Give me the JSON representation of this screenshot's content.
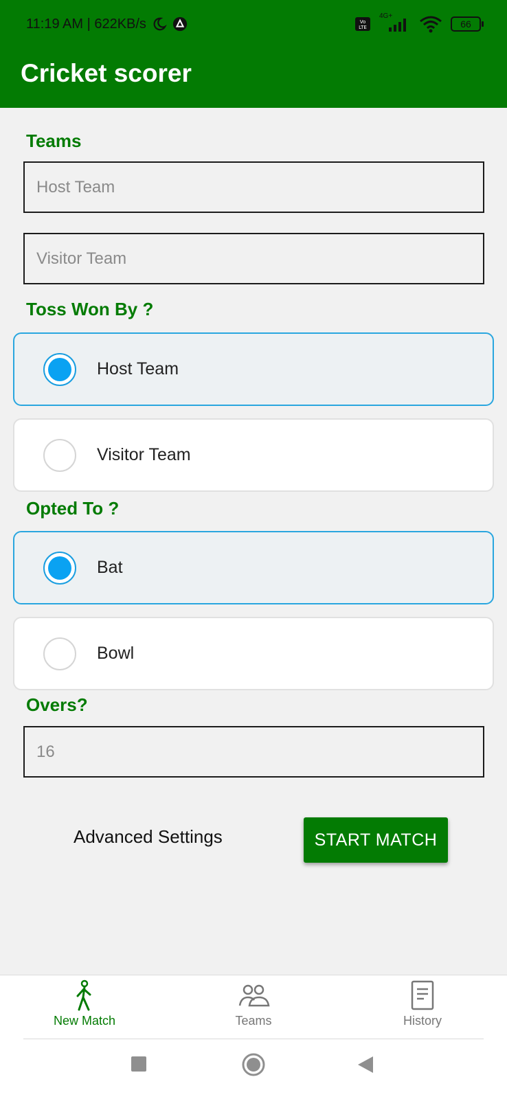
{
  "status_bar": {
    "time_speed": "11:19 AM | 622KB/s",
    "network_label": "4G+",
    "battery": "66"
  },
  "header": {
    "title": "Cricket scorer"
  },
  "teams": {
    "title": "Teams",
    "host_placeholder": "Host Team",
    "visitor_placeholder": "Visitor Team"
  },
  "toss": {
    "title": "Toss Won By ?",
    "options": [
      {
        "label": "Host Team",
        "selected": true
      },
      {
        "label": "Visitor Team",
        "selected": false
      }
    ]
  },
  "opted": {
    "title": "Opted To ?",
    "options": [
      {
        "label": "Bat",
        "selected": true
      },
      {
        "label": "Bowl",
        "selected": false
      }
    ]
  },
  "overs": {
    "title": "Overs?",
    "placeholder": "16"
  },
  "actions": {
    "advanced_label": "Advanced Settings",
    "start_label": "START MATCH"
  },
  "bottom_nav": {
    "items": [
      {
        "label": "New Match",
        "icon": "walking-person-icon",
        "active": true
      },
      {
        "label": "Teams",
        "icon": "people-icon",
        "active": false
      },
      {
        "label": "History",
        "icon": "document-icon",
        "active": false
      }
    ]
  },
  "colors": {
    "primary_green": "#037b03",
    "radio_blue": "#0aa2f2",
    "selected_border": "#29a6df"
  }
}
